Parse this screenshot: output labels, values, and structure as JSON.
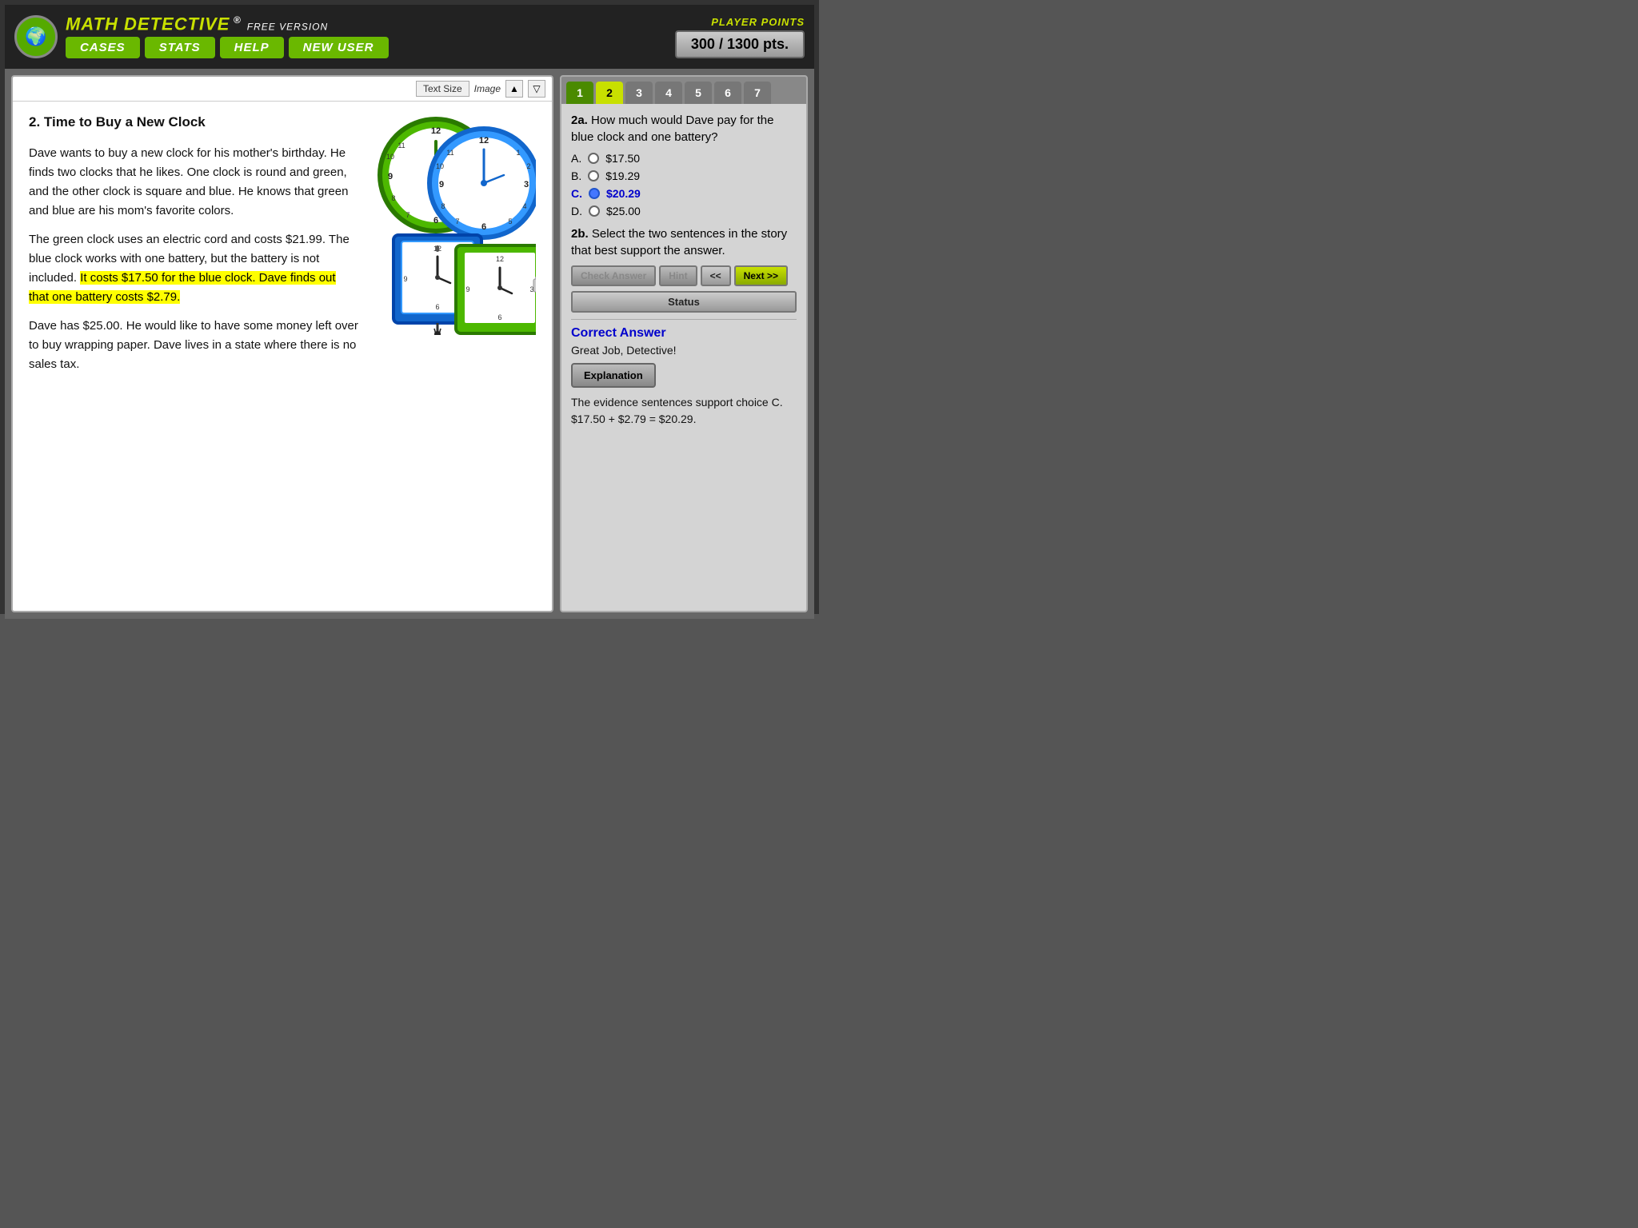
{
  "header": {
    "logo_symbol": "🌍",
    "brand_title": "MATH DETECTIVE",
    "brand_subtitle": "® FREE VERSION",
    "nav": {
      "cases": "CASES",
      "stats": "STATS",
      "help": "HELP",
      "new_user": "NEW USER"
    },
    "player_points_label": "PLAYER POINTS",
    "player_points_value": "300 / 1300 pts."
  },
  "toolbar": {
    "text_size_label": "Text Size",
    "image_label": "Image",
    "arrow_up": "▲",
    "arrow_down": "▽"
  },
  "story": {
    "title": "2. Time to Buy a New Clock",
    "paragraph1": "Dave wants to buy a new clock for his mother's birthday. He finds two clocks that he likes. One clock is round and green, and the other clock is square and blue. He knows that green and blue are his mom's favorite colors.",
    "paragraph2_before": "The green clock uses an electric cord and costs $21.99. The blue clock works with one battery, but the battery is not included. ",
    "paragraph2_highlight": "It costs $17.50 for the blue clock. Dave finds out that one battery costs $2.79.",
    "paragraph3": "Dave has $25.00. He would like to have some money left over to buy wrapping paper. Dave lives in a state where there is no sales tax."
  },
  "questions": {
    "tabs": [
      "1",
      "2",
      "3",
      "4",
      "5",
      "6",
      "7"
    ],
    "active_tab": 1,
    "question_2a_label": "How much would Dave pay for the blue clock and one battery?",
    "question_2b_label": "Select the two sentences in the story that best support the answer.",
    "options": [
      {
        "label": "A.",
        "value": "$17.50",
        "selected": false,
        "correct": false
      },
      {
        "label": "B.",
        "value": "$19.29",
        "selected": false,
        "correct": false
      },
      {
        "label": "C.",
        "value": "$20.29",
        "selected": true,
        "correct": true
      },
      {
        "label": "D.",
        "value": "$25.00",
        "selected": false,
        "correct": false
      }
    ],
    "check_answer_label": "Check Answer",
    "hint_label": "Hint",
    "prev_label": "<< ",
    "next_label": "Next >>",
    "status_label": "Status"
  },
  "feedback": {
    "correct_answer_label": "Correct Answer",
    "great_job_text": "Great Job, Detective!",
    "explanation_btn_label": "Explanation",
    "explanation_text": "The evidence sentences support choice C. $17.50 + $2.79 = $20.29."
  }
}
